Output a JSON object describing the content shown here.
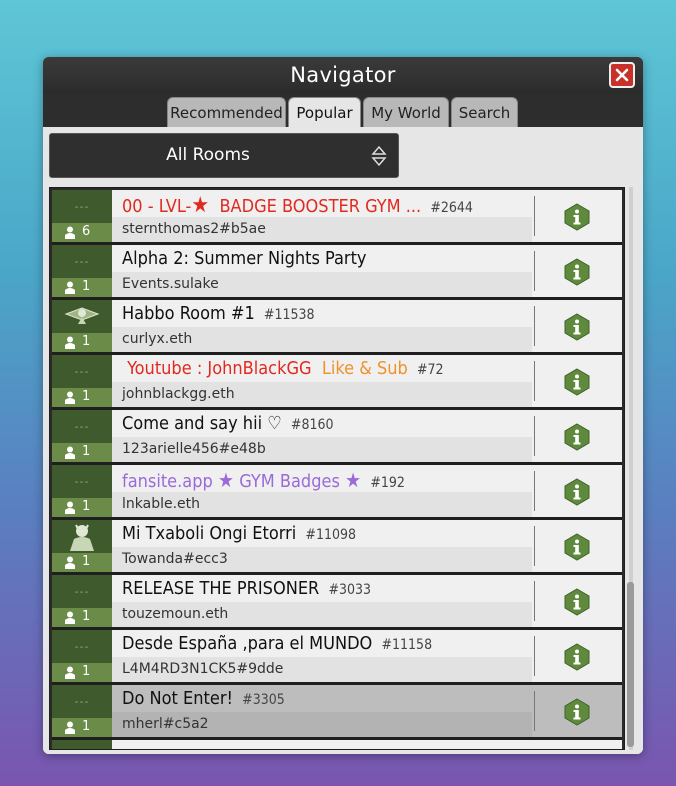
{
  "window": {
    "title": "Navigator",
    "close_label": "×"
  },
  "tabs": [
    {
      "label": "Recommended",
      "active": false
    },
    {
      "label": "Popular",
      "active": true
    },
    {
      "label": "My World",
      "active": false
    },
    {
      "label": "Search",
      "active": false
    }
  ],
  "filter": {
    "selected": "All Rooms"
  },
  "rooms": [
    {
      "title_a": "00 - LVL-",
      "star": "★",
      "title_b": "BADGE BOOSTER GYM ...",
      "number": "#2644",
      "owner": "sternthomas2#b5ae",
      "users": "6",
      "thumb": "---"
    },
    {
      "title_a": "Alpha 2: Summer Nights Party",
      "number": "",
      "owner": "Events.sulake",
      "users": "1",
      "thumb": "---"
    },
    {
      "title_a": "Habbo Room #1",
      "number": "#11538",
      "owner": "curlyx.eth",
      "users": "1",
      "thumb": ""
    },
    {
      "title_a": "Youtube : JohnBlackGG",
      "title_b": "Like & Sub",
      "number": "#72",
      "owner": "johnblackgg.eth",
      "users": "1",
      "thumb": "---"
    },
    {
      "title_a": "Come and say hii",
      "heart": "♡",
      "number": "#8160",
      "owner": "123arielle456#e48b",
      "users": "1",
      "thumb": "---"
    },
    {
      "title_a": "fansite.app",
      "star": "★",
      "title_b": "GYM Badges",
      "star2": "★",
      "number": "#192",
      "owner": "lnkable.eth",
      "users": "1",
      "thumb": "---"
    },
    {
      "title_a": "Mi Txaboli Ongi Etorri",
      "number": "#11098",
      "owner": "Towanda#ecc3",
      "users": "1",
      "thumb": ""
    },
    {
      "title_a": "RELEASE THE PRISONER",
      "number": "#3033",
      "owner": "touzemoun.eth",
      "users": "1",
      "thumb": "---"
    },
    {
      "title_a": "Desde España ,para el MUNDO",
      "number": "#11158",
      "owner": "L4M4RD3N1CK5#9dde",
      "users": "1",
      "thumb": "---"
    },
    {
      "title_a": "Do Not Enter!",
      "number": "#3305",
      "owner": "mherl#c5a2",
      "users": "1",
      "thumb": "---"
    }
  ],
  "colors": {
    "accent_red": "#e02a20",
    "accent_orange": "#f0922a",
    "accent_purple": "#9a6ad8",
    "info_green": "#5f8a3e"
  }
}
